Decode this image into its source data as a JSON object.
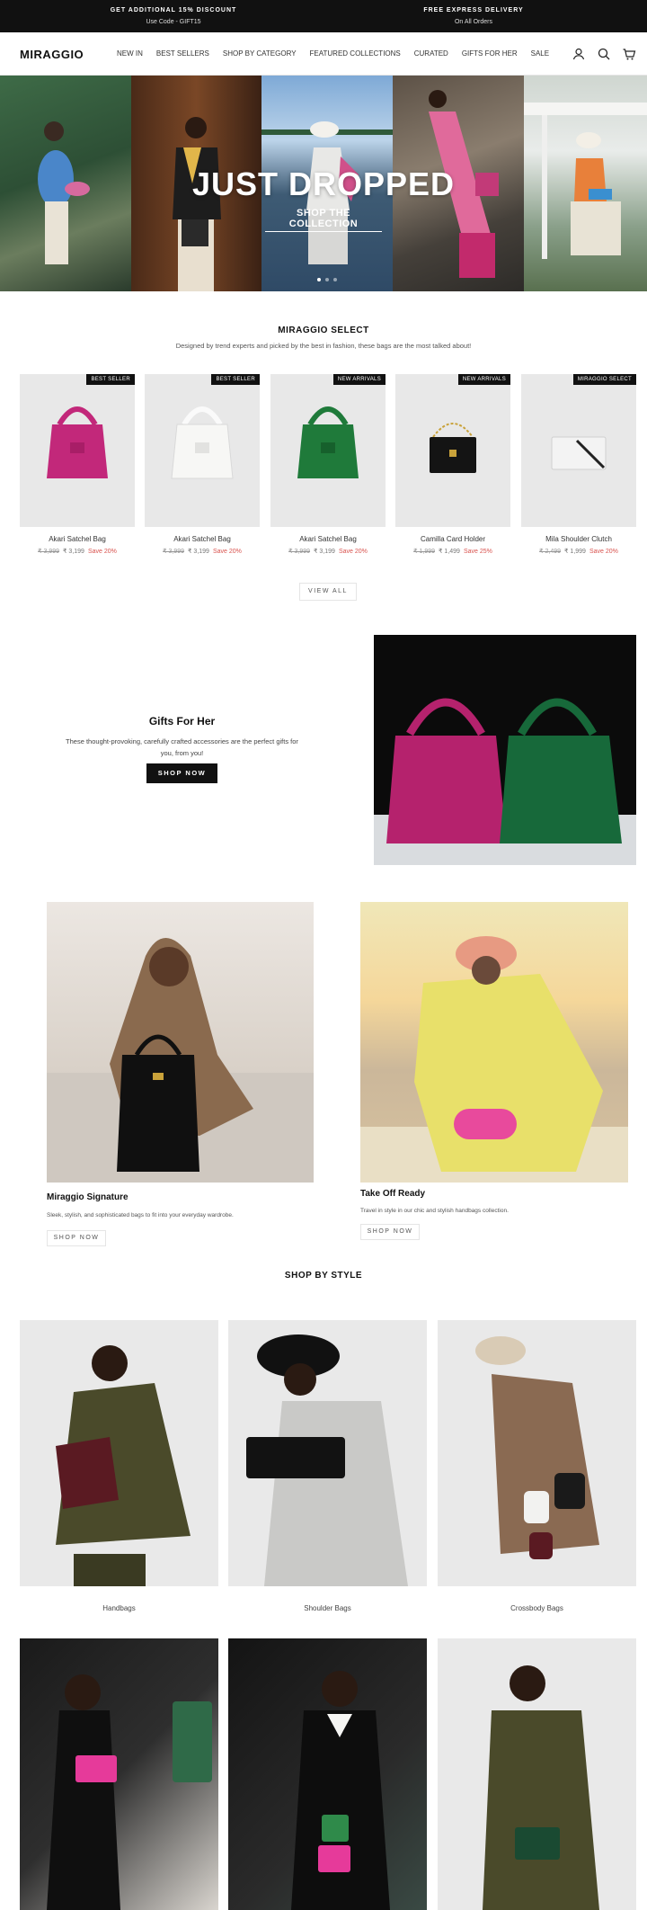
{
  "announcement": {
    "left": {
      "title": "GET ADDITIONAL 15% DISCOUNT",
      "subtitle": "Use Code - GIFT15"
    },
    "right": {
      "title": "FREE EXPRESS DELIVERY",
      "subtitle": "On All Orders"
    }
  },
  "header": {
    "logo": "MIRAGGIO",
    "nav": [
      "NEW IN",
      "BEST SELLERS",
      "SHOP BY CATEGORY",
      "FEATURED COLLECTIONS",
      "CURATED",
      "GIFTS FOR HER",
      "SALE"
    ],
    "icons": [
      "account-icon",
      "search-icon",
      "cart-icon"
    ]
  },
  "hero": {
    "title": "JUST DROPPED",
    "cta": "SHOP THE COLLECTION",
    "slides": 3,
    "active_slide": 1
  },
  "select": {
    "title": "MIRAGGIO SELECT",
    "subtitle": "Designed by trend experts and picked by the best in fashion, these bags are the most talked about!",
    "products": [
      {
        "badge": "BEST SELLER",
        "name": "Akari Satchel Bag",
        "old_price": "₹ 3,999",
        "price": "₹ 3,199",
        "save": "Save 20%",
        "color": "#c2287a"
      },
      {
        "badge": "BEST SELLER",
        "name": "Akari Satchel Bag",
        "old_price": "₹ 3,999",
        "price": "₹ 3,199",
        "save": "Save 20%",
        "color": "#f2f2f0"
      },
      {
        "badge": "NEW ARRIVALS",
        "name": "Akari Satchel Bag",
        "old_price": "₹ 3,999",
        "price": "₹ 3,199",
        "save": "Save 20%",
        "color": "#1f7a3a"
      },
      {
        "badge": "NEW ARRIVALS",
        "name": "Camilla Card Holder",
        "old_price": "₹ 1,999",
        "price": "₹ 1,499",
        "save": "Save 25%",
        "color": "#111111"
      },
      {
        "badge": "MIRAGGIO SELECT",
        "name": "Mila Shoulder Clutch",
        "old_price": "₹ 2,499",
        "price": "₹ 1,999",
        "save": "Save 20%",
        "color": "#efefef"
      }
    ],
    "view_all": "VIEW ALL"
  },
  "gifts": {
    "title": "Gifts For Her",
    "description": "These thought-provoking, carefully crafted accessories are the perfect gifts for you, from you!",
    "cta": "SHOP NOW"
  },
  "features": [
    {
      "title": "Miraggio Signature",
      "description": "Sleek, stylish, and sophisticated bags to fit into your everyday wardrobe.",
      "cta": "SHOP NOW"
    },
    {
      "title": "Take Off Ready",
      "description": "Travel in style in our chic and stylish handbags collection.",
      "cta": "SHOP NOW"
    }
  ],
  "styles": {
    "title": "SHOP BY STYLE",
    "items": [
      "Handbags",
      "Shoulder Bags",
      "Crossbody Bags"
    ]
  }
}
